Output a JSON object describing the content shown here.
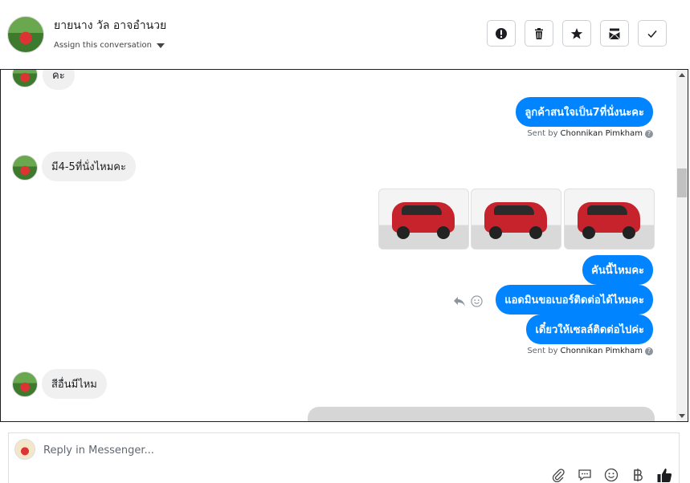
{
  "header": {
    "contact_name": "ยายนาง วัล อาจอำนวย",
    "assign_label": "Assign this conversation",
    "actions": [
      {
        "name": "spam-button",
        "icon": "alert-icon"
      },
      {
        "name": "delete-button",
        "icon": "trash-icon"
      },
      {
        "name": "star-button",
        "icon": "star-icon"
      },
      {
        "name": "mark-unread-button",
        "icon": "envelope-icon"
      },
      {
        "name": "done-button",
        "icon": "check-icon"
      }
    ]
  },
  "messages": {
    "in_0": "คะ",
    "out_1": "ลูกค้าสนใจเป็น7ที่นั่งนะคะ",
    "sent_by_1_prefix": "Sent by",
    "sent_by_1_name": "Chonnikan Pimkham",
    "in_2": "มี4-5ที่นั่งไหมคะ",
    "out_3": "คันนี้ไหมคะ",
    "out_4": "แอดมินขอเบอร์ติดต่อได้ไหมคะ",
    "out_5": "เดี๋ยวให้เซลล์ติดต่อไปค่ะ",
    "sent_by_2_prefix": "Sent by",
    "sent_by_2_name": "Chonnikan Pimkham",
    "in_6": "สีอื่นมีไหม"
  },
  "reply": {
    "placeholder": "Reply in Messenger..."
  },
  "colors": {
    "outgoing_bubble": "#0084ff",
    "incoming_bubble": "#f0f0f0"
  }
}
